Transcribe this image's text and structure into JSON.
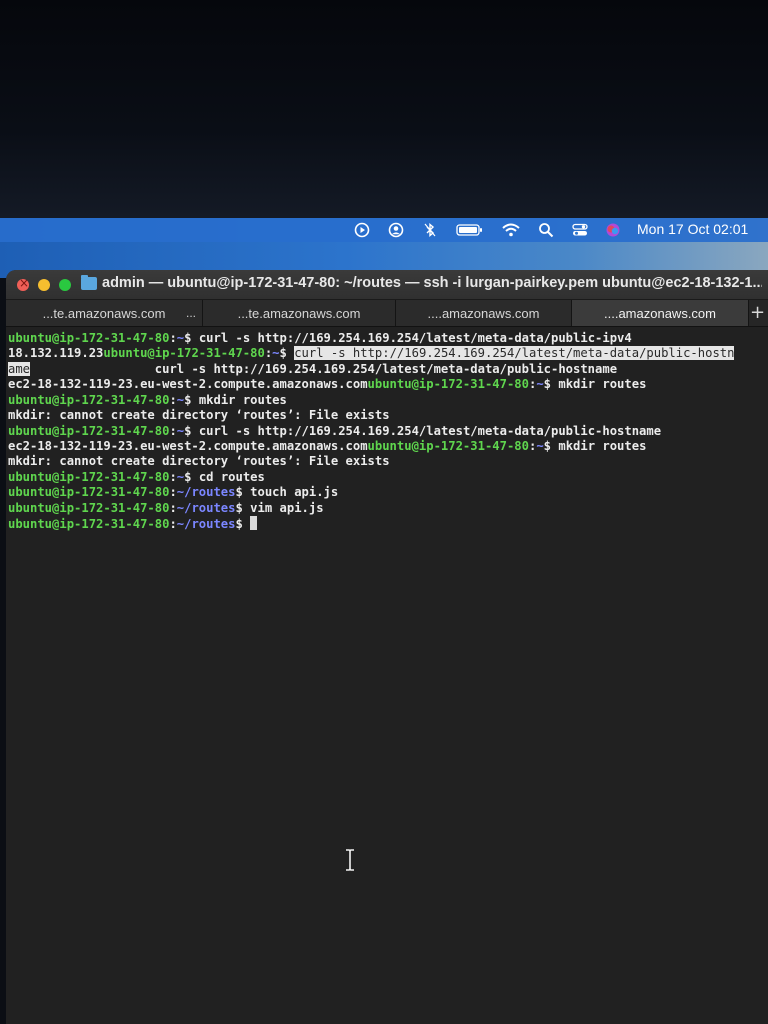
{
  "menubar": {
    "clock": "Mon 17 Oct  02:01",
    "icons": [
      "play-circle-icon",
      "user-circle-icon",
      "bluetooth-off-icon",
      "battery-icon",
      "wifi-icon",
      "search-icon",
      "control-center-icon",
      "siri-icon"
    ]
  },
  "window": {
    "title": "admin — ubuntu@ip-172-31-47-80: ~/routes — ssh -i lurgan-pairkey.pem ubuntu@ec2-18-132-1...",
    "tabs": [
      {
        "label": "...te.amazonaws.com",
        "more": "..."
      },
      {
        "label": "...te.amazonaws.com"
      },
      {
        "label": "....amazonaws.com"
      },
      {
        "label": "....amazonaws.com",
        "active": true
      }
    ],
    "new_tab": "+"
  },
  "terminal": {
    "prompt_user": "ubuntu@ip-172-31-47-80",
    "lines": {
      "l1_cmd": "curl -s http://169.254.169.254/latest/meta-data/public-ipv4",
      "l2_out": "18.132.119.23",
      "l2_sel": "curl -s http://169.254.169.254/latest/meta-data/public-hostn",
      "l3_sel": "ame",
      "l3_cmd": "curl -s http://169.254.169.254/latest/meta-data/public-hostname",
      "l4_out": "ec2-18-132-119-23.eu-west-2.compute.amazonaws.com",
      "l4_cmd": "mkdir routes",
      "l5_cmd": "mkdir routes",
      "l6_out": "mkdir: cannot create directory ‘routes’: File exists",
      "l7_cmd": "curl -s http://169.254.169.254/latest/meta-data/public-hostname",
      "l8_out": "ec2-18-132-119-23.eu-west-2.compute.amazonaws.com",
      "l8_cmd": "mkdir routes",
      "l9_out": "mkdir: cannot create directory ‘routes’: File exists",
      "l10_cmd": "cd routes",
      "l11_cmd": "touch api.js",
      "l12_cmd": "vim api.js"
    },
    "home_path": "~",
    "routes_path": "~/routes",
    "prompt_sym": "$"
  },
  "colors": {
    "prompt_user": "#5fd64e",
    "path": "#7b86ff",
    "background": "#212121"
  }
}
